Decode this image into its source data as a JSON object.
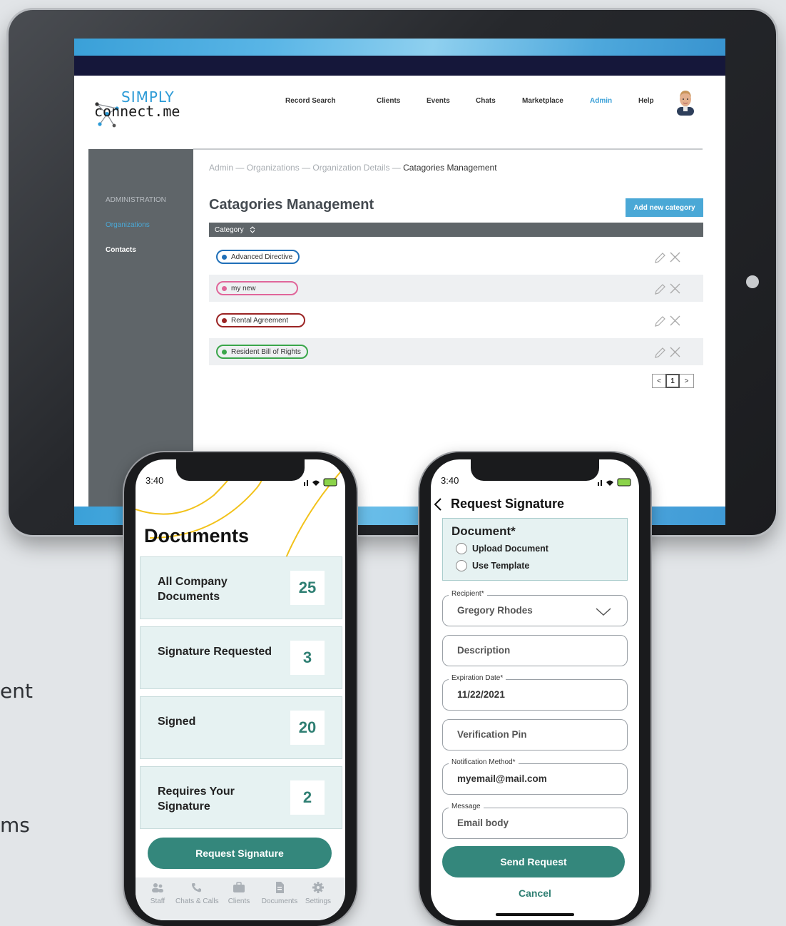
{
  "background_text": [
    "ent",
    "ms"
  ],
  "web_app": {
    "logo": {
      "line1": "SIMPLY",
      "line2": "connect.me"
    },
    "nav": [
      "Record Search",
      "Clients",
      "Events",
      "Chats",
      "Marketplace",
      "Admin",
      "Help"
    ],
    "active_nav": "Admin",
    "sidebar": {
      "section": "ADMINISTRATION",
      "items": [
        {
          "label": "Organizations",
          "active": true
        },
        {
          "label": "Contacts",
          "active": false
        }
      ]
    },
    "breadcrumb": {
      "links": [
        "Admin",
        "Organizations",
        "Organization Details"
      ],
      "separator": " — ",
      "current": "Catagories Management"
    },
    "page_title": "Catagories Management",
    "add_button": "Add new category",
    "table_header": "Category",
    "categories": [
      {
        "label": "Advanced Directive",
        "color": "#1f6fb8"
      },
      {
        "label": "my new",
        "color": "#e0669a"
      },
      {
        "label": "Rental Agreement",
        "color": "#9b2424"
      },
      {
        "label": "Resident Bill of Rights",
        "color": "#3aa64a"
      }
    ],
    "pager": {
      "prev": "<",
      "page": "1",
      "next": ">"
    }
  },
  "phone_documents": {
    "time": "3:40",
    "title": "Documents",
    "cards": [
      {
        "label": "All Company Documents",
        "count": "25"
      },
      {
        "label": "Signature Requested",
        "count": "3"
      },
      {
        "label": "Signed",
        "count": "20"
      },
      {
        "label": "Requires Your Signature",
        "count": "2"
      }
    ],
    "button": "Request Signature",
    "tabs": [
      "Staff",
      "Chats & Calls",
      "Clients",
      "Documents",
      "Settings"
    ]
  },
  "phone_request": {
    "time": "3:40",
    "title": "Request Signature",
    "document": {
      "label": "Document*",
      "options": [
        "Upload Document",
        "Use Template"
      ]
    },
    "fields": [
      {
        "label": "Recipient*",
        "value": "Gregory Rhodes",
        "dropdown": true
      },
      {
        "label": "",
        "value": "Description"
      },
      {
        "label": "Expiration Date*",
        "value": "11/22/2021"
      },
      {
        "label": "",
        "value": "Verification Pin"
      },
      {
        "label": "Notification Method*",
        "value": "myemail@mail.com"
      },
      {
        "label": "Message",
        "value": "Email body"
      }
    ],
    "send_button": "Send Request",
    "cancel": "Cancel"
  },
  "colors": {
    "accent_blue": "#3aa0d8",
    "teal": "#34877c",
    "sidebar_gray": "#5f6569",
    "navy": "#15173a"
  }
}
